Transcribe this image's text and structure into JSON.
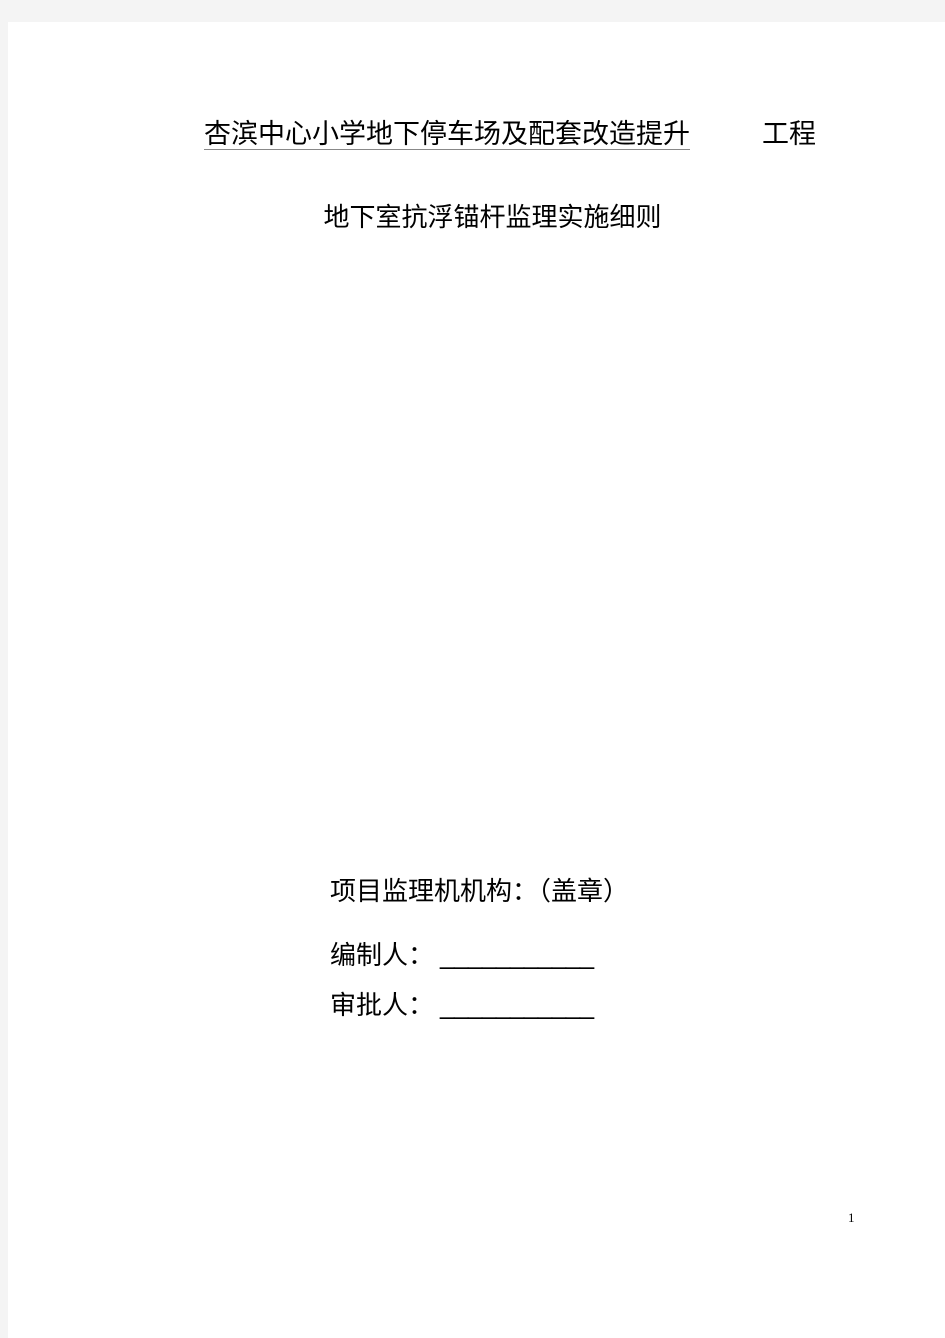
{
  "document": {
    "page_background": "#ffffff",
    "gutter_color": "#f4f4f4",
    "text_color": "#000000",
    "underline_color": "#888888"
  },
  "title": {
    "project_name": "杏滨中心小学地下停车场及配套改造提升",
    "project_suffix": "工程",
    "subtitle": "地下室抗浮锚杆监理实施细则"
  },
  "signature": {
    "org_line": "项目监理机机构：（盖章）",
    "prepared_by_label": "编制人：",
    "prepared_by_rule": "___________",
    "approved_by_label": "审批人：",
    "approved_by_rule": "___________"
  },
  "footer": {
    "page_number": "1"
  }
}
